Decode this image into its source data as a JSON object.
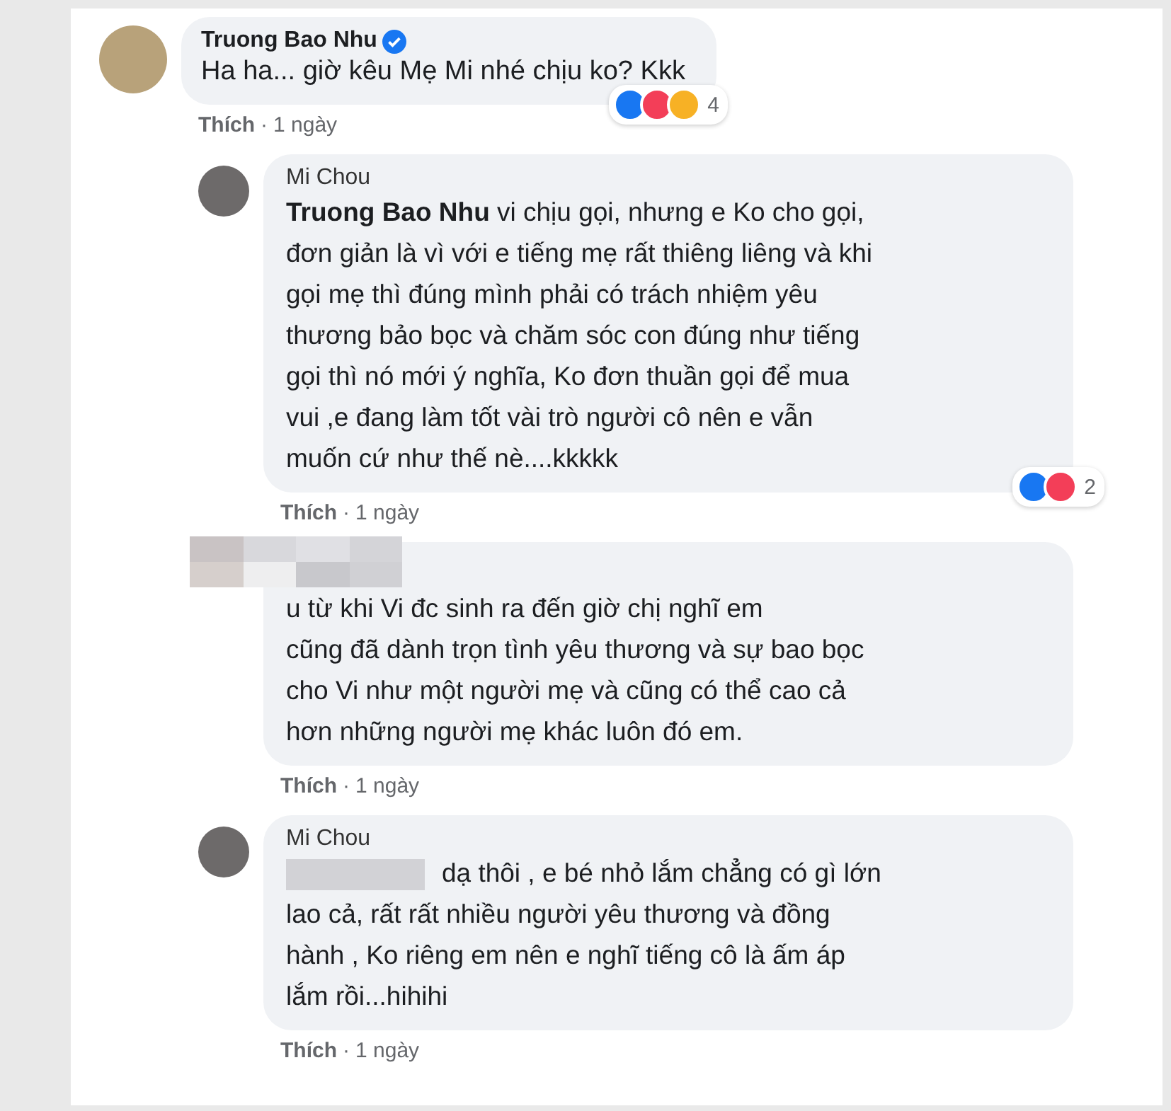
{
  "comments": [
    {
      "author": "Truong Bao Nhu",
      "verified": true,
      "text": "Ha ha... giờ kêu Mẹ Mi nhé chịu ko? Kkk",
      "action": "Thích",
      "separator": "·",
      "time": "1 ngày",
      "reactions": [
        {
          "kind": "like"
        },
        {
          "kind": "love"
        },
        {
          "kind": "haha"
        }
      ],
      "reaction_count": "4",
      "replies": [
        {
          "author": "Mi Chou",
          "text": "**Truong Bao Nhu** vi chịu gọi, nhưng e Ko cho gọi,\nđơn giản là vì với e tiếng mẹ rất thiêng liêng và khi\ngọi mẹ thì đúng mình phải có trách nhiệm yêu\nthương bảo bọc và chăm sóc con đúng như tiếng\ngọi thì nó mới ý nghĩa, Ko đơn thuần gọi để mua\nvui ,e đang làm tốt vài trò người cô nên e vẫn\nmuốn cứ như thế nè....kkkkk",
          "action": "Thích",
          "separator": "·",
          "time": "1 ngày",
          "reactions": [
            {
              "kind": "like"
            },
            {
              "kind": "love"
            }
          ],
          "reaction_count": "2"
        },
        {
          "author_hidden": true,
          "text": "u từ khi Vi đc sinh ra đến giờ chị nghĩ em\ncũng đã dành trọn tình yêu thương và sự bao bọc\ncho Vi như một người mẹ và cũng có thể cao cả\nhơn những người mẹ khác luôn đó em.",
          "action": "Thích",
          "separator": "·",
          "time": "1 ngày"
        },
        {
          "author": "Mi Chou",
          "mention_hidden": true,
          "text": "dạ thôi , e bé nhỏ lắm chẳng có gì lớn\nlao cả, rất rất nhiều người yêu thương và đồng\nhành , Ko riêng em nên e nghĩ tiếng cô là ấm áp\nlắm rồi...hihihi",
          "action": "Thích",
          "separator": "·",
          "time": "1 ngày"
        }
      ]
    }
  ]
}
